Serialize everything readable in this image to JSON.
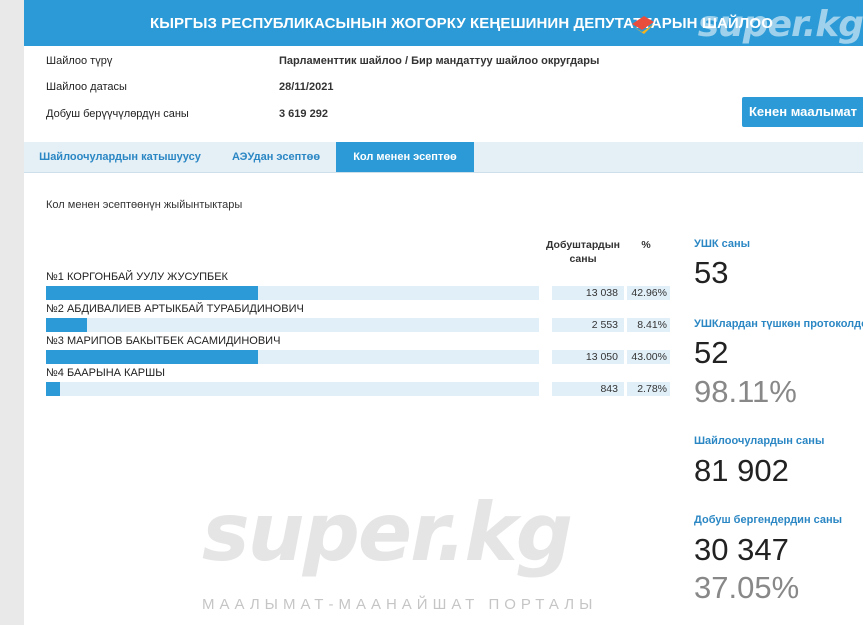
{
  "header": {
    "title": "КЫРГЫЗ РЕСПУБЛИКАСЫНЫН ЖОГОРКУ КЕҢЕШИНИН ДЕПУТАТТАРЫН ШАЙЛОО",
    "logo_text": "super.kg"
  },
  "info": {
    "rows": [
      {
        "label": "Шайлоо түрү",
        "value": "Парламенттик шайлоо / Бир мандаттуу шайлоо округдары"
      },
      {
        "label": "Шайлоо датасы",
        "value": "28/11/2021"
      },
      {
        "label": "Добуш берүүчүлөрдүн саны",
        "value": "3 619 292"
      }
    ],
    "more_button": "Кенен маалымат"
  },
  "tabs": [
    {
      "label": "Шайлоочулардын катышуусу"
    },
    {
      "label": "АЭУдан эсептөө"
    },
    {
      "label": "Кол менен эсептөө"
    }
  ],
  "results": {
    "title": "Кол менен эсептөөнүн жыйынтыктары",
    "col_votes_line1": "Добуштардын",
    "col_votes_line2": "саны",
    "col_pct": "%",
    "candidates": [
      {
        "name": "№1 КОРГОНБАЙ УУЛУ ЖУСУПБЕК",
        "votes": "13 038",
        "pct": "42.96%",
        "share": 42.96
      },
      {
        "name": "№2 АБДИВАЛИЕВ АРТЫКБАЙ ТУРАБИДИНОВИЧ",
        "votes": "2 553",
        "pct": "8.41%",
        "share": 8.41
      },
      {
        "name": "№3 МАРИПОВ БАКЫТБЕК АСАМИДИНОВИЧ",
        "votes": "13 050",
        "pct": "43.00%",
        "share": 43.0
      },
      {
        "name": "№4 БААРЫНА КАРШЫ",
        "votes": "843",
        "pct": "2.78%",
        "share": 2.78
      }
    ]
  },
  "stats": {
    "ushk_label": "УШК саны",
    "ushk_value": "53",
    "protocols_label": "УШКлардан түшкөн протоколдор",
    "protocols_value": "52",
    "protocols_pct": "98.11%",
    "voters_label": "Шайлоочулардын саны",
    "voters_value": "81 902",
    "voted_label": "Добуш бергендердин саны",
    "voted_value": "30 347",
    "voted_pct": "37.05%"
  },
  "watermark": {
    "logo": "super.kg",
    "subtitle": "МААЛЫМАТ-МААНАЙШАТ ПОРТАЛЫ"
  },
  "colors": {
    "accent": "#2b9ad6",
    "track": "#e1eff8"
  }
}
